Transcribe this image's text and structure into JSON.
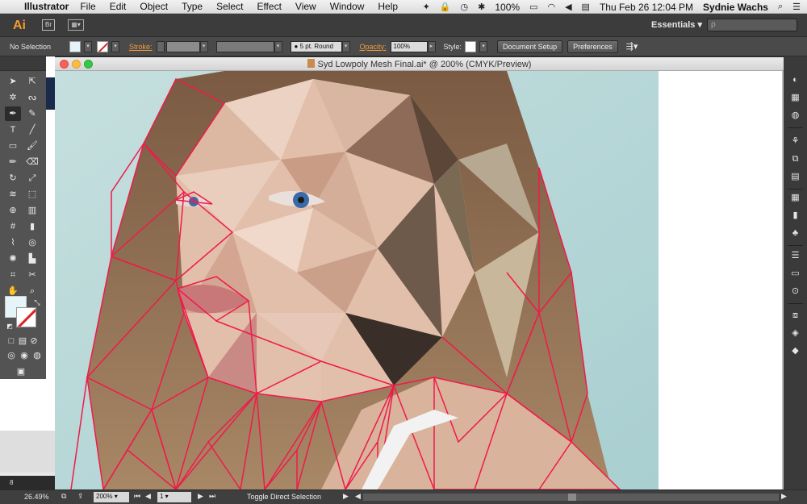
{
  "menubar": {
    "app_name": "Illustrator",
    "items": [
      "File",
      "Edit",
      "Object",
      "Type",
      "Select",
      "Effect",
      "View",
      "Window",
      "Help"
    ],
    "battery": "100%",
    "datetime": "Thu Feb 26  12:04 PM",
    "user": "Sydnie Wachs"
  },
  "appbar": {
    "logo": "Ai",
    "bridge": "Br",
    "workspace": "Essentials",
    "search_placeholder": "ρ"
  },
  "controlbar": {
    "selection": "No Selection",
    "stroke_label": "Stroke:",
    "brush": "●  5 pt. Round",
    "opacity_label": "Opacity:",
    "opacity_value": "100%",
    "style_label": "Style:",
    "doc_setup": "Document Setup",
    "preferences": "Preferences"
  },
  "document": {
    "title": "Syd Lowpoly Mesh Final.ai* @ 200% (CMYK/Preview)"
  },
  "statusbar": {
    "zoom_left": "26.49%",
    "zoom": "200%",
    "page": "1",
    "status": "Toggle Direct Selection",
    "left_ruler": "8"
  },
  "colors": {
    "fill": "#e5f4f8",
    "mesh_stroke": "#f01a4a",
    "canvas_bg": "#b8d8d8"
  }
}
